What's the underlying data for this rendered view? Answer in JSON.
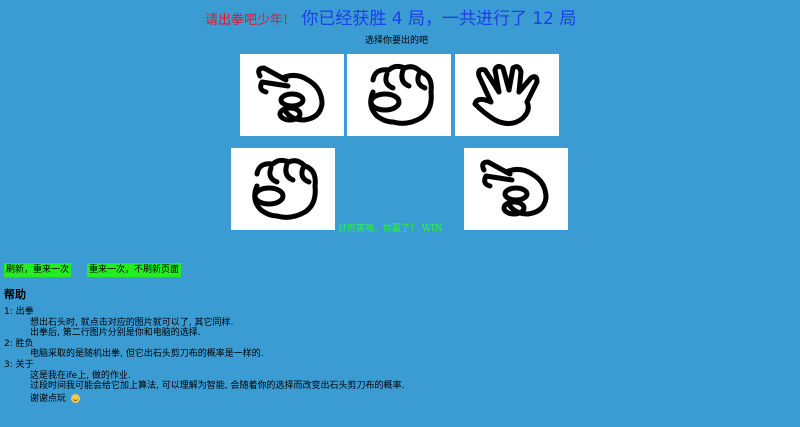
{
  "header": {
    "prompt": "请出拳吧少年!",
    "score": "你已经获胜 4 局，一共进行了 12 局"
  },
  "choose_label": "选择你要出的吧",
  "choices": [
    {
      "name": "scissors",
      "icon": "scissors-hand-icon"
    },
    {
      "name": "rock",
      "icon": "rock-fist-icon"
    },
    {
      "name": "paper",
      "icon": "paper-hand-icon"
    }
  ],
  "results": {
    "player": {
      "name": "rock",
      "icon": "rock-fist-icon"
    },
    "computer": {
      "name": "scissors",
      "icon": "scissors-hand-icon"
    },
    "verdict": "好厉害哦，你赢了！ WIN"
  },
  "actions": {
    "refresh_label": "刷新，重来一次",
    "restart_label": "重来一次，不刷新页面"
  },
  "help": {
    "title": "帮助",
    "s1_title": "1: 出拳",
    "s1_l1": "想出石头时, 就点击对应的图片就可以了, 其它同样.",
    "s1_l2": "出拳后, 第二行图片分别是你和电脑的选择.",
    "s2_title": "2: 胜负",
    "s2_l1": "电脑采取的是随机出拳, 但它出石头剪刀布的概率是一样的.",
    "s3_title": "3: 关于",
    "s3_l1": "这是我在ife上, 做的作业.",
    "s3_l2": "过段时间我可能会给它加上算法, 可以理解为智能, 会随着你的选择而改变出石头剪刀布的概率.",
    "s3_l3": "谢谢点玩"
  },
  "colors": {
    "background": "#3b9cd3",
    "prompt": "#e0182d",
    "score": "#1d3fe8",
    "win": "#22ff22",
    "button": "#22ee22"
  }
}
